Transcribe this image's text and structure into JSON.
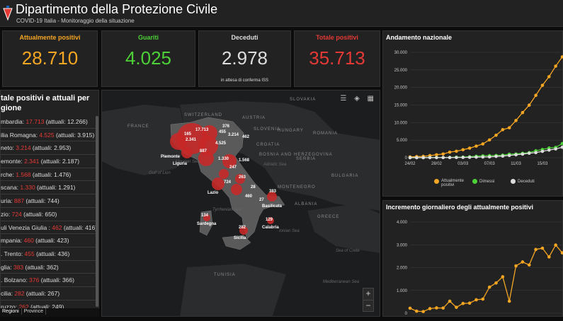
{
  "header": {
    "title": "Dipartimento della Protezione Civile",
    "subtitle": "COVID-19 Italia - Monitoraggio della situazione"
  },
  "colors": {
    "positive": "#f5a623",
    "healed": "#4cd137",
    "dead": "#dddddd",
    "total": "#e53935",
    "panel": "#222222"
  },
  "kpis": {
    "attuali": {
      "label": "Attualmente positivi",
      "value": "28.710"
    },
    "guariti": {
      "label": "Guariti",
      "value": "4.025"
    },
    "deceduti": {
      "label": "Deceduti",
      "value": "2.978",
      "note": "in attesa di conferma ISS"
    },
    "totale": {
      "label": "Totale positivi",
      "value": "35.713"
    }
  },
  "left_panel": {
    "title": "tale positivi e attuali per gione",
    "regions": [
      {
        "name": "mbardia: ",
        "tot": "17.713",
        "att": " (attuali: 12.266)"
      },
      {
        "name": "ilia Romagna: ",
        "tot": "4.525",
        "att": " (attuali: 3.915)"
      },
      {
        "name": "neto: ",
        "tot": "3.214",
        "att": " (attuali: 2.953)"
      },
      {
        "name": "emonte: ",
        "tot": "2.341",
        "att": " (attuali: 2.187)"
      },
      {
        "name": "rche: ",
        "tot": "1.568",
        "att": " (attuali: 1.476)"
      },
      {
        "name": "scana: ",
        "tot": "1.330",
        "att": " (attuali: 1.291)"
      },
      {
        "name": "uria: ",
        "tot": "887",
        "att": " (attuali: 744)"
      },
      {
        "name": "zio: ",
        "tot": "724",
        "att": " (attuali: 650)"
      },
      {
        "name": "uli Venezia Giulia : ",
        "tot": "462",
        "att": " (attuali: 416)"
      },
      {
        "name": "mpania: ",
        "tot": "460",
        "att": " (attuali: 423)"
      },
      {
        "name": ". Trento: ",
        "tot": "455",
        "att": " (attuali: 436)"
      },
      {
        "name": "glia: ",
        "tot": "383",
        "att": " (attuali: 362)"
      },
      {
        "name": ". Bolzano: ",
        "tot": "376",
        "att": " (attuali: 366)"
      },
      {
        "name": "cilia: ",
        "tot": "282",
        "att": " (attuali: 267)"
      },
      {
        "name": "ruzzo: ",
        "tot": "262",
        "att": " (attuali: 249)"
      },
      {
        "name": "mbria: ",
        "tot": "247",
        "att": " (attuali: 241)"
      }
    ],
    "tabs": [
      "Regioni",
      "Province"
    ]
  },
  "map": {
    "countries": [
      {
        "label": "SWITZERLAND"
      },
      {
        "label": "AUSTRIA"
      },
      {
        "label": "HUNGARY"
      },
      {
        "label": "SLOVAKIA"
      },
      {
        "label": "FRANCE"
      },
      {
        "label": "SLOVENIA"
      },
      {
        "label": "CROATIA"
      },
      {
        "label": "ROMANIA"
      },
      {
        "label": "BOSNIA AND HERZEGOVINA"
      },
      {
        "label": "SERBIA"
      },
      {
        "label": "BULGARIA"
      },
      {
        "label": "MONTENEGRO"
      },
      {
        "label": "ALBANIA"
      },
      {
        "label": "GREECE"
      },
      {
        "label": "TUNISIA"
      }
    ],
    "seas": [
      {
        "label": "Gulf of Lion"
      },
      {
        "label": "Adriatic Sea"
      },
      {
        "label": "Tyrrhenian Sea"
      },
      {
        "label": "Ionian Sea"
      },
      {
        "label": "Sea of Crete"
      },
      {
        "label": "Mediterranean Sea"
      },
      {
        "label": "Ligurian Sea"
      }
    ],
    "regions": [
      {
        "label": "Piemonte"
      },
      {
        "label": "Liguria"
      },
      {
        "label": "Lazio"
      },
      {
        "label": "Basilicata"
      },
      {
        "label": "Sardegna"
      },
      {
        "label": "Calabria"
      },
      {
        "label": "Sicilia"
      }
    ],
    "counts": [
      "17.713",
      "376",
      "455",
      "165",
      "2.341",
      "3.214",
      "462",
      "4.525",
      "887",
      "1.330",
      "1.568",
      "247",
      "263",
      "724",
      "28",
      "383",
      "460",
      "27",
      "134",
      "129",
      "282"
    ],
    "zoom_in": "+",
    "zoom_out": "−"
  },
  "chart1": {
    "title": "Andamento nazionale"
  },
  "chart2": {
    "title": "Incremento giornaliero degli attualmente positivi"
  },
  "chart_data": [
    {
      "type": "line",
      "title": "Andamento nazionale",
      "ylim": [
        0,
        30000
      ],
      "yticks": [
        "0",
        "5.000",
        "10.000",
        "15.000",
        "20.000",
        "25.000",
        "30.000"
      ],
      "x": [
        "24/02",
        "25/02",
        "26/02",
        "27/02",
        "28/02",
        "29/02",
        "01/03",
        "02/03",
        "03/03",
        "04/03",
        "05/03",
        "06/03",
        "07/03",
        "08/03",
        "09/03",
        "10/03",
        "11/03",
        "12/03",
        "13/03",
        "14/03",
        "15/03",
        "16/03",
        "17/03",
        "18/03"
      ],
      "xticks": [
        "24/02",
        "28/02",
        "03/03",
        "07/03",
        "11/03",
        "15/03"
      ],
      "series": [
        {
          "name": "Attualmente positivi",
          "values": [
            221,
            311,
            385,
            588,
            821,
            1049,
            1577,
            1835,
            2263,
            2706,
            3296,
            3916,
            5061,
            6387,
            7985,
            8514,
            10590,
            12839,
            14955,
            17750,
            20603,
            23073,
            26062,
            28710
          ]
        },
        {
          "name": "Dimessi",
          "values": [
            1,
            1,
            3,
            45,
            46,
            50,
            83,
            149,
            160,
            276,
            414,
            523,
            589,
            622,
            724,
            1004,
            1045,
            1258,
            1439,
            1966,
            2335,
            2749,
            2941,
            4025
          ]
        },
        {
          "name": "Deceduti",
          "values": [
            7,
            10,
            12,
            17,
            21,
            29,
            34,
            52,
            79,
            107,
            148,
            197,
            233,
            366,
            463,
            631,
            827,
            1016,
            1266,
            1441,
            1809,
            2158,
            2503,
            2978
          ]
        }
      ]
    },
    {
      "type": "line",
      "title": "Incremento giornaliero degli attualmente positivi",
      "ylim": [
        0,
        4000
      ],
      "yticks": [
        "0",
        "1.000",
        "2.000",
        "3.000",
        "4.000"
      ],
      "series": [
        {
          "name": "Attualmente positivi",
          "values": [
            221,
            90,
            74,
            203,
            233,
            228,
            528,
            258,
            428,
            443,
            590,
            620,
            1145,
            1326,
            1598,
            529,
            2076,
            2249,
            2116,
            2795,
            2853,
            2470,
            2989,
            2648
          ]
        }
      ]
    }
  ]
}
